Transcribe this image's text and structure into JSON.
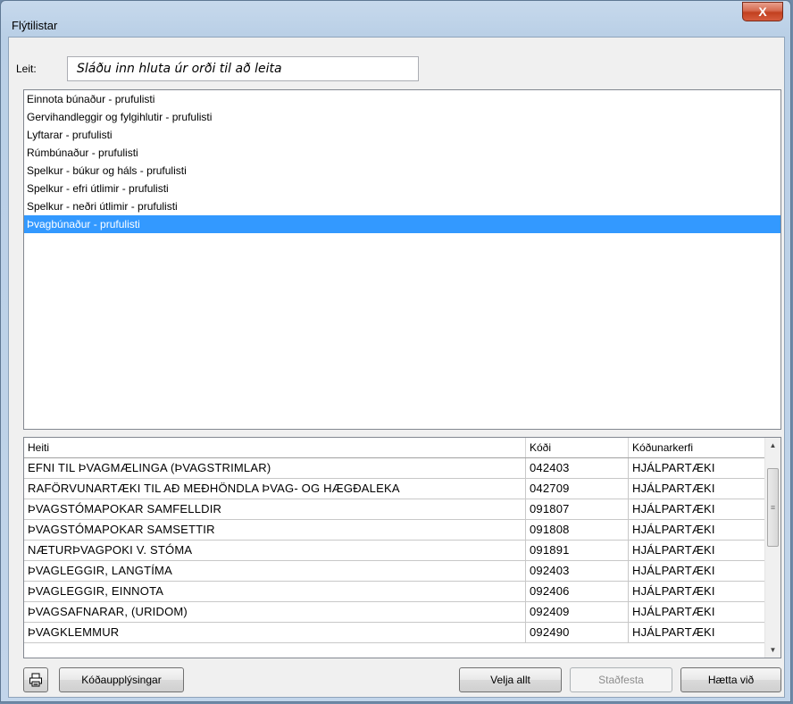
{
  "window": {
    "title": "Flýtilistar",
    "close_glyph": "X"
  },
  "search": {
    "label": "Leit:",
    "placeholder": "Sláðu inn hluta úr orði til að leita"
  },
  "list": {
    "items": [
      "Einnota búnaður - prufulisti",
      "Gervihandleggir og fylgihlutir - prufulisti",
      "Lyftarar - prufulisti",
      "Rúmbúnaður - prufulisti",
      "Spelkur - búkur og háls - prufulisti",
      "Spelkur - efri útlimir - prufulisti",
      "Spelkur - neðri útlimir - prufulisti",
      "Þvagbúnaður - prufulisti"
    ],
    "selected_index": 7
  },
  "grid": {
    "columns": [
      "Heiti",
      "Kóði",
      "Kóðunarkerfi"
    ],
    "rows": [
      [
        "EFNI TIL ÞVAGMÆLINGA (ÞVAGSTRIMLAR)",
        "042403",
        "HJÁLPARTÆKI"
      ],
      [
        "RAFÖRVUNARTÆKI TIL AÐ MEÐHÖNDLA ÞVAG- OG HÆGÐALEKA",
        "042709",
        "HJÁLPARTÆKI"
      ],
      [
        "ÞVAGSTÓMAPOKAR SAMFELLDIR",
        "091807",
        "HJÁLPARTÆKI"
      ],
      [
        "ÞVAGSTÓMAPOKAR SAMSETTIR",
        "091808",
        "HJÁLPARTÆKI"
      ],
      [
        "NÆTURÞVAGPOKI V. STÓMA",
        "091891",
        "HJÁLPARTÆKI"
      ],
      [
        "ÞVAGLEGGIR, LANGTÍMA",
        "092403",
        "HJÁLPARTÆKI"
      ],
      [
        "ÞVAGLEGGIR, EINNOTA",
        "092406",
        "HJÁLPARTÆKI"
      ],
      [
        "ÞVAGSAFNARAR, (URIDOM)",
        "092409",
        "HJÁLPARTÆKI"
      ],
      [
        "ÞVAGKLEMMUR",
        "092490",
        "HJÁLPARTÆKI"
      ]
    ]
  },
  "buttons": {
    "codes_info": "Kóðaupplýsingar",
    "select_all": "Velja allt",
    "confirm": "Staðfesta",
    "cancel": "Hætta við"
  },
  "icons": {
    "print": "printer-icon",
    "close": "close-icon"
  }
}
